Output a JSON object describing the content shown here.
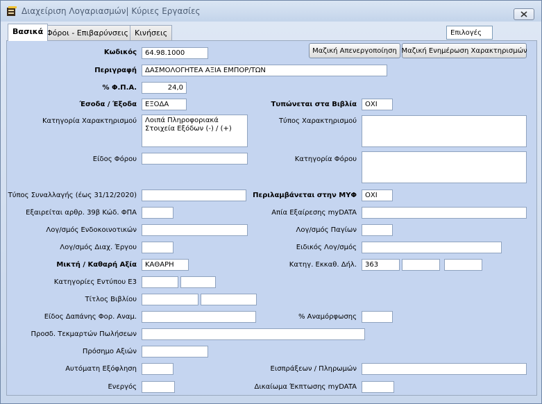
{
  "window": {
    "title": "Διαχείριση Λογαριασμών| Κύριες Εργασίες"
  },
  "tabs": [
    {
      "label": "Βασικά",
      "active": true
    },
    {
      "label": "Φόροι - Επιβαρύνσεις",
      "active": false
    },
    {
      "label": "Κινήσεις",
      "active": false
    }
  ],
  "options": {
    "label": "Επιλογές"
  },
  "buttons": {
    "mass_deactivation": "Μαζική Απενεργοποίηση",
    "mass_update_characterizations": "Μαζική Ενημέρωση Χαρακτηρισμών"
  },
  "form": {
    "code": {
      "label": "Κωδικός",
      "value": "64.98.1000"
    },
    "description": {
      "label": "Περιγραφή",
      "value": "ΔΑΣΜΟΛΟΓΗΤΕΑ ΑΞΙΑ  ΕΜΠΟΡ/ΤΩΝ"
    },
    "vat": {
      "label": "% Φ.Π.Α.",
      "value": "24,0"
    },
    "income_expense": {
      "label": "Έσοδα / Έξοδα",
      "value": "ΕΞΟΔΑ"
    },
    "printed_in_books": {
      "label": "Τυπώνεται στα Βιβλία",
      "value": "ΟΧΙ"
    },
    "characterization_category": {
      "label": "Κατηγορία Χαρακτηρισμού",
      "value": "Λοιπά Πληροφοριακά Στοιχεία Εξόδων (-) / (+)"
    },
    "characterization_type": {
      "label": "Τύπος Χαρακτηρισμού",
      "value": ""
    },
    "tax_type": {
      "label": "Είδος Φόρου",
      "value": ""
    },
    "tax_category": {
      "label": "Κατηγορία Φόρου",
      "value": ""
    },
    "transaction_type": {
      "label": "Τύπος Συναλλαγής (έως 31/12/2020)",
      "value": ""
    },
    "included_in_myf": {
      "label": "Περιλαμβάνεται στην ΜΥΦ",
      "value": "ΟΧΙ"
    },
    "exempt_39b": {
      "label": "Εξαιρείται αρθρ. 39β Κώδ. ΦΠΑ",
      "value": ""
    },
    "exemption_reason_mydata": {
      "label": "Απία Εξαίρεσης myDATA",
      "value": ""
    },
    "intra_community_account": {
      "label": "Λογ/σμός Ενδοκοινοτικών",
      "value": ""
    },
    "fixed_assets_account": {
      "label": "Λογ/σμός  Παγίων",
      "value": ""
    },
    "project_admin_account": {
      "label": "Λογ/σμός Διαχ. Έργου",
      "value": ""
    },
    "special_account": {
      "label": "Ειδικός Λογ/σμός",
      "value": ""
    },
    "gross_net_value": {
      "label": "Μικτή  / Καθαρή Αξία",
      "value": "ΚΑΘΑΡΗ"
    },
    "tax_return_category": {
      "label": "Κατηγ. Εκκαθ. Δήλ.",
      "values": [
        "363",
        "",
        ""
      ]
    },
    "e3_categories": {
      "label": "Κατηγορίες Εντύπου Ε3",
      "values": [
        "",
        ""
      ]
    },
    "book_title": {
      "label": "Τίτλος Βιβλίου",
      "values": [
        "",
        ""
      ]
    },
    "fixed_asset_expense_type": {
      "label": "Είδος Δαπάνης Φορ. Αναμ.",
      "value": ""
    },
    "reformation_percent": {
      "label": "% Αναμόρφωσης",
      "value": ""
    },
    "sales_presumption_addition": {
      "label": "Προσδ. Τεκμαρτών Πωλήσεων",
      "value": ""
    },
    "value_sign": {
      "label": "Πρόσημο Αξιών",
      "value": ""
    },
    "auto_settlement": {
      "label": "Αυτόματη Εξόφληση",
      "value": ""
    },
    "receipts_payments": {
      "label": "Εισπράξεων / Πληρωμών",
      "value": ""
    },
    "active": {
      "label": "Ενεργός",
      "value": ""
    },
    "mydata_deduction_right": {
      "label": "Δικαίωμα Έκπτωσης myDATA",
      "value": ""
    }
  }
}
